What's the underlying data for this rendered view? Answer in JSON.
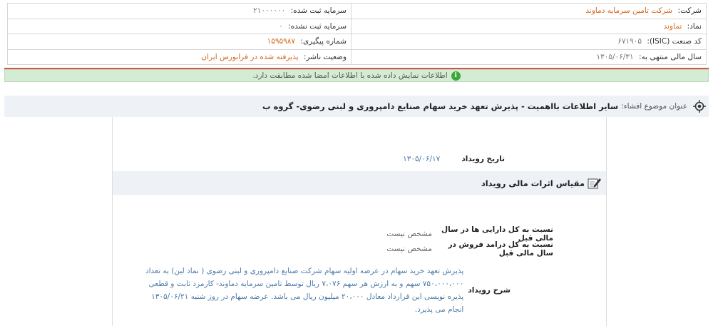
{
  "company_info": {
    "company_label": "شرکت:",
    "company_value": "شرکت تامین سرمایه دماوند",
    "registered_capital_label": "سرمایه ثبت شده:",
    "registered_capital_value": "۲۱۰۰۰۰۰۰",
    "symbol_label": "نماد:",
    "symbol_value": "تماوند",
    "unregistered_capital_label": "سرمایه ثبت نشده:",
    "unregistered_capital_value": "۰",
    "isic_label": "کد صنعت (ISIC):",
    "isic_value": "۶۷۱۹۰۵",
    "tracking_label": "شماره پیگیری:",
    "tracking_value": "۱۵۹۵۹۸۷",
    "fiscal_label": "سال مالی منتهی به:",
    "fiscal_value": "۱۳۰۵/۰۶/۳۱",
    "status_label": "وضعیت ناشر:",
    "status_value": "پذیرفته شده در فرابورس ایران"
  },
  "alert": {
    "text": "اطلاعات نمایش داده شده با اطلاعات امضا شده مطابقت دارد."
  },
  "subject": {
    "label": "عنوان موضوع افشاء:",
    "value": "سایر اطلاعات بااهمیت - پذیرش تعهد خرید سهام صنایع دامپروری و لبنی رضوی- گروه ب"
  },
  "event": {
    "date_label": "تاریخ رویداد",
    "date_value": "۱۳۰۵/۰۶/۱۷"
  },
  "section": {
    "title": "مقیاس اثرات مالی رویداد"
  },
  "ratios": [
    {
      "label": "نسبت به کل دارایی ها در سال مالی قبل",
      "value": "مشخص نیست"
    },
    {
      "label": "نسبت به کل درامد فروش در سال مالی قبل",
      "value": "مشخص نیست"
    }
  ],
  "description": {
    "label": "شرح رویداد",
    "text": "پذیرش تعهد خرید سهام در عرضه اولیه سهام شرکت صنایع دامپروری و لبنی رضوی ( نماد لبن) به تعداد ۷۵۰،۰۰۰،۰۰۰ سهم و به ارزش هر سهم ۷،۰۷۶ ریال توسط تامین سرمایه دماوند- کارمزد ثابت و قطعی پذیره نویسی این قرارداد معادل ۲۰،۰۰۰ میلیون ریال می باشد. عرضه سهام در روز شنبه ۱۳۰۵/۰۶/۲۱ انجام می پذیرد."
  },
  "colors": {
    "accent_orange": "#d2691e",
    "link_blue": "#4a7aa8",
    "alert_green": "#d4ecd3",
    "icon_green": "#3aa83a",
    "divider_red": "#d9534f"
  },
  "icons": {
    "info": "info-icon",
    "subject": "target-icon",
    "section": "edit-icon"
  }
}
